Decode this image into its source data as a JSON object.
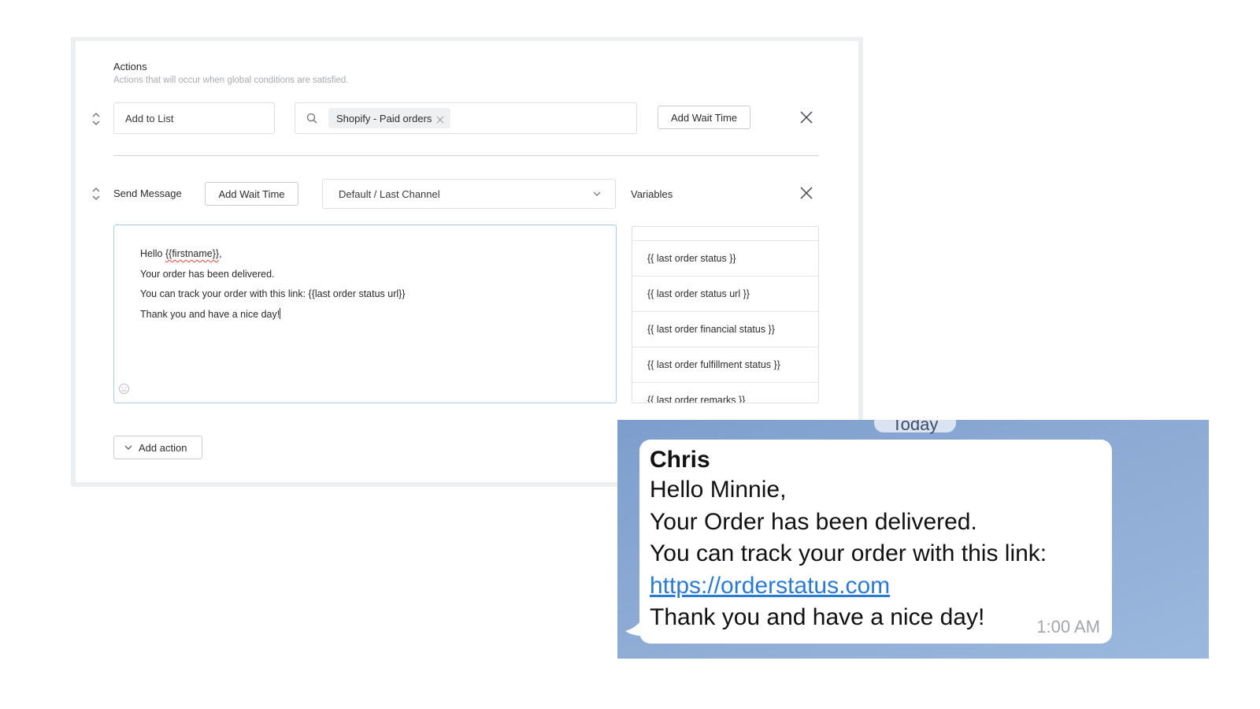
{
  "actions": {
    "title": "Actions",
    "subtitle": "Actions that will occur when global conditions are satisfied.",
    "add_to_list_row": {
      "action_value": "Add to List",
      "list_chip": "Shopify - Paid orders",
      "wait_button": "Add Wait Time"
    },
    "send_message_row": {
      "label": "Send Message",
      "wait_button": "Add Wait Time",
      "channel_select": "Default / Last Channel",
      "variables_label": "Variables"
    },
    "editor": {
      "lines": {
        "greeting_prefix": "Hello ",
        "greeting_var": "{{firstname}}",
        "greeting_suffix": ",",
        "line2": "Your order has been delivered.",
        "line3": "You can track your order with this link: {{last order status url}}",
        "line4": "Thank you and have a nice day!"
      }
    },
    "variables": [
      "{{ last order status }}",
      "{{ last order status url }}",
      "{{ last order financial status }}",
      "{{ last order fulfillment status }}",
      "{{ last order remarks }}"
    ],
    "add_action_button": "Add action"
  },
  "chat_preview": {
    "date_pill": "Today",
    "sender": "Chris",
    "lines": {
      "line1": "Hello Minnie,",
      "line2": "Your Order has been delivered.",
      "line3": "You can track your order with this link:",
      "link": "https://orderstatus.com",
      "line5": "Thank you and have a nice day!"
    },
    "time": "1:00 AM"
  },
  "colors": {
    "editor_border": "#a9cbe3",
    "link": "#2a7ad4",
    "chat_background": "#8caad3",
    "divider": "#cfd2d6"
  },
  "icons": [
    "reorder-icon",
    "search-icon",
    "close-icon",
    "chevron-down-icon",
    "emoji-icon",
    "remove-chip-icon"
  ]
}
